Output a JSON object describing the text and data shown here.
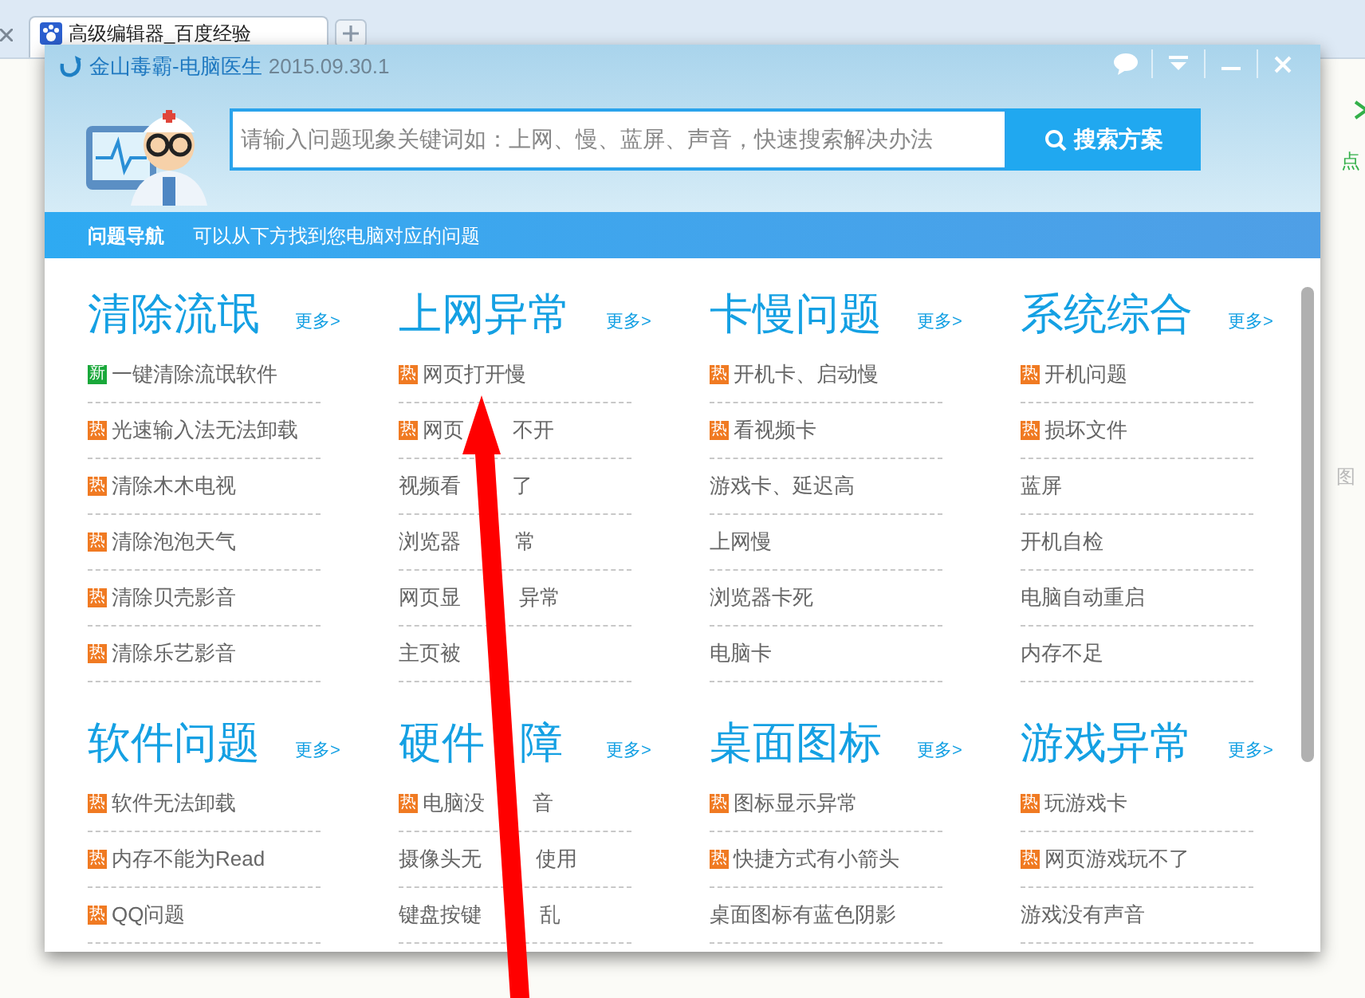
{
  "browser": {
    "tabs": [
      {
        "title": "高级编辑器_百度经验",
        "selected": true
      }
    ],
    "side_texts": [
      "点",
      "图"
    ]
  },
  "window": {
    "app_name": "金山毒霸-电脑医生",
    "version": "2015.09.30.1"
  },
  "search": {
    "placeholder": "请输入问题现象关键词如：上网、慢、蓝屏、声音，快速搜索解决办法",
    "button": "搜索方案"
  },
  "nav": {
    "title": "问题导航",
    "hint": "可以从下方找到您电脑对应的问题"
  },
  "sections": [
    {
      "title": "清除流氓",
      "more": "更多>",
      "items": [
        {
          "text": "一键清除流氓软件",
          "badge": "新"
        },
        {
          "text": "光速输入法无法卸载",
          "badge": "热"
        },
        {
          "text": "清除木木电视",
          "badge": "热"
        },
        {
          "text": "清除泡泡天气",
          "badge": "热"
        },
        {
          "text": "清除贝壳影音",
          "badge": "热"
        },
        {
          "text": "清除乐艺影音",
          "badge": "热"
        }
      ]
    },
    {
      "title": "上网异常",
      "more": "更多>",
      "items": [
        {
          "text": "网页打开慢",
          "badge": "热"
        },
        {
          "text_parts": [
            "网页",
            "不开"
          ],
          "badge": "热"
        },
        {
          "text_parts": [
            "视频看",
            "了"
          ]
        },
        {
          "text_parts": [
            "浏览器",
            "常"
          ]
        },
        {
          "text_parts": [
            "网页显",
            "异常"
          ]
        },
        {
          "text": "主页被"
        }
      ]
    },
    {
      "title": "卡慢问题",
      "more": "更多>",
      "items": [
        {
          "text": "开机卡、启动慢",
          "badge": "热"
        },
        {
          "text": "看视频卡",
          "badge": "热"
        },
        {
          "text": "游戏卡、延迟高"
        },
        {
          "text": "上网慢"
        },
        {
          "text": "浏览器卡死"
        },
        {
          "text": "电脑卡"
        }
      ]
    },
    {
      "title": "系统综合",
      "more": "更多>",
      "items": [
        {
          "text": "开机问题",
          "badge": "热"
        },
        {
          "text": "损坏文件",
          "badge": "热"
        },
        {
          "text": "蓝屏"
        },
        {
          "text": "开机自检"
        },
        {
          "text": "电脑自动重启"
        },
        {
          "text": "内存不足"
        }
      ]
    },
    {
      "title": "软件问题",
      "more": "更多>",
      "items": [
        {
          "text": "软件无法卸载",
          "badge": "热"
        },
        {
          "text": "内存不能为Read",
          "badge": "热"
        },
        {
          "text": "QQ问题",
          "badge": "热"
        }
      ]
    },
    {
      "title_parts": [
        "硬件",
        "障"
      ],
      "more": "更多>",
      "items": [
        {
          "text_parts": [
            "电脑没",
            "音"
          ],
          "badge": "热"
        },
        {
          "text_parts": [
            "摄像头无",
            "使用"
          ]
        },
        {
          "text_parts": [
            "键盘按键",
            "乱"
          ]
        }
      ]
    },
    {
      "title": "桌面图标",
      "more": "更多>",
      "items": [
        {
          "text": "图标显示异常",
          "badge": "热"
        },
        {
          "text": "快捷方式有小箭头",
          "badge": "热"
        },
        {
          "text": "桌面图标有蓝色阴影"
        }
      ]
    },
    {
      "title": "游戏异常",
      "more": "更多>",
      "items": [
        {
          "text": "玩游戏卡",
          "badge": "热"
        },
        {
          "text": "网页游戏玩不了",
          "badge": "热"
        },
        {
          "text": "游戏没有声音"
        }
      ]
    }
  ]
}
